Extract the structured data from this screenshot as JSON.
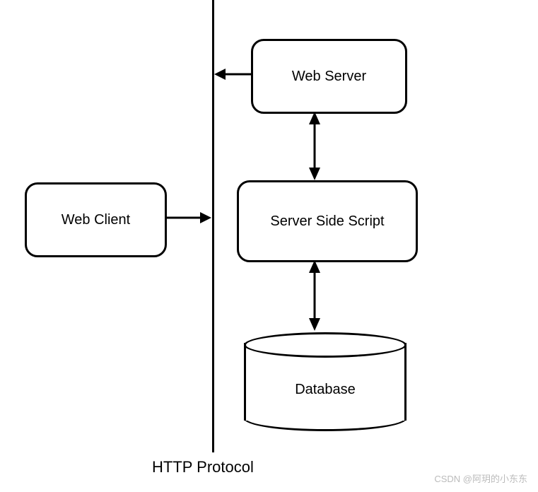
{
  "nodes": {
    "web_client": "Web Client",
    "web_server": "Web Server",
    "server_side_script": "Server Side Script",
    "database": "Database"
  },
  "protocol_label": "HTTP Protocol",
  "watermark": "CSDN @阿玥的小东东"
}
